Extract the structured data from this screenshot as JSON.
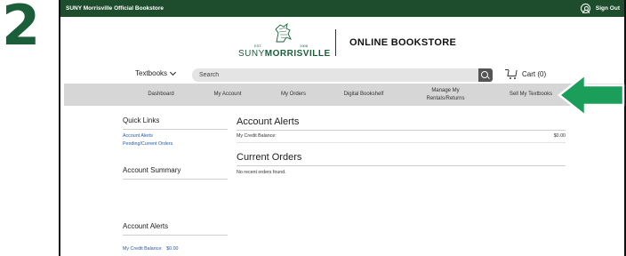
{
  "step": {
    "number": "2"
  },
  "topbar": {
    "store_name": "SUNY Morrisville Official Bookstore",
    "signout_label": "Sign Out"
  },
  "brand": {
    "est_left": "EST.",
    "est_year": "1908",
    "suny": "SUNY",
    "morrisville": "MORRISVILLE",
    "title": "ONLINE BOOKSTORE"
  },
  "search": {
    "textbooks_label": "Textbooks",
    "placeholder": "Search",
    "value": ""
  },
  "cart": {
    "label": "Cart (0)"
  },
  "nav": {
    "items": [
      {
        "label": "Dashboard"
      },
      {
        "label": "My Account"
      },
      {
        "label": "My Orders"
      },
      {
        "label": "Digital Bookshelf"
      },
      {
        "label": "Manage My",
        "label2": "Rentals/Returns"
      },
      {
        "label": "Sell My Textbooks"
      }
    ]
  },
  "sidebar": {
    "quick_links_title": "Quick Links",
    "links": [
      "Account Alerts",
      "Pending/Current Orders"
    ],
    "account_summary_title": "Account Summary",
    "alerts_title": "Account Alerts",
    "credit_label": "My Credit Balance:",
    "credit_value": "$0.00"
  },
  "main": {
    "alerts_title": "Account Alerts",
    "credit_label": "My Credit Balance:",
    "credit_value": "$0.00",
    "orders_title": "Current Orders",
    "orders_empty": "No recent orders found."
  },
  "colors": {
    "brand_green": "#1e4d2e",
    "arrow_green": "#1b9e5a",
    "link_blue": "#2a59a3",
    "nav_gray": "#d6d6d6"
  },
  "icons": {
    "user": "user-icon",
    "search": "search-icon",
    "cart": "cart-icon",
    "chevron": "chevron-down-icon",
    "arrow": "arrow-left-icon"
  }
}
